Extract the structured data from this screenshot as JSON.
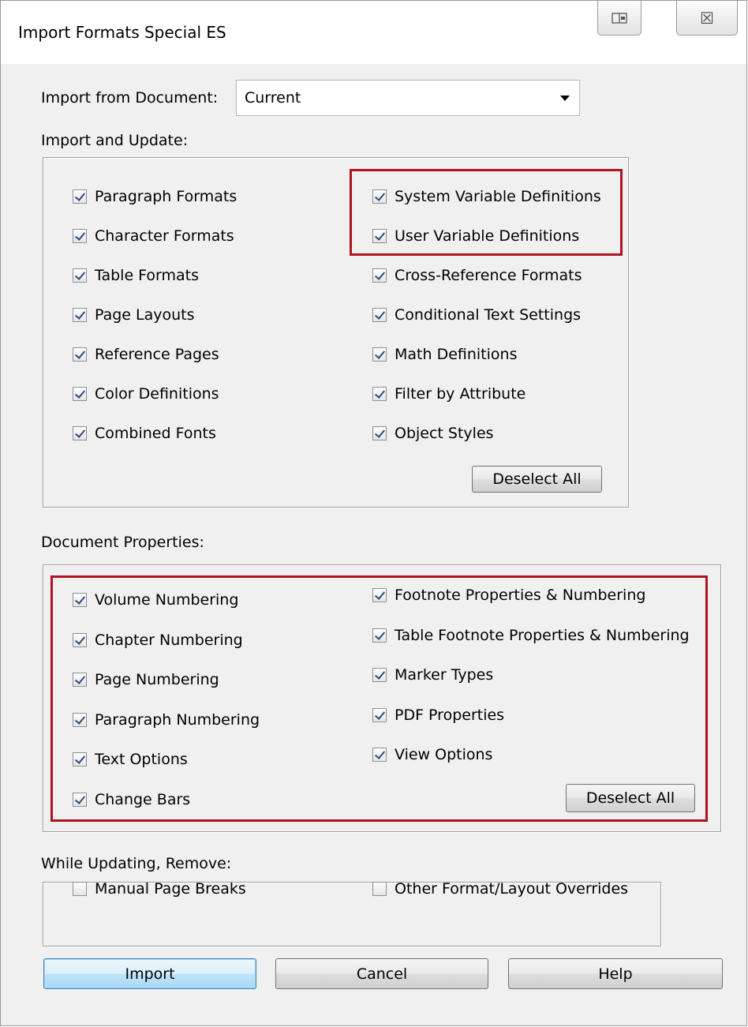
{
  "window": {
    "title": "Import Formats Special ES",
    "buttons": [
      "restore-icon",
      "close-icon"
    ],
    "close_glyph": "☒"
  },
  "import_from": {
    "label": "Import from Document:",
    "value": "Current"
  },
  "import_update": {
    "label": "Import and Update:",
    "left": [
      {
        "label": "Paragraph Formats",
        "checked": true
      },
      {
        "label": "Character Formats",
        "checked": true
      },
      {
        "label": "Table Formats",
        "checked": true
      },
      {
        "label": "Page Layouts",
        "checked": true
      },
      {
        "label": "Reference Pages",
        "checked": true
      },
      {
        "label": "Color Definitions",
        "checked": true
      },
      {
        "label": "Combined Fonts",
        "checked": true
      }
    ],
    "right": [
      {
        "label": "System Variable Definitions",
        "checked": true
      },
      {
        "label": "User Variable Definitions",
        "checked": true
      },
      {
        "label": "Cross-Reference Formats",
        "checked": true
      },
      {
        "label": "Conditional Text Settings",
        "checked": true
      },
      {
        "label": "Math Definitions",
        "checked": true
      },
      {
        "label": "Filter by Attribute",
        "checked": true
      },
      {
        "label": "Object Styles",
        "checked": true
      }
    ],
    "deselect_label": "Deselect All"
  },
  "doc_props": {
    "label": "Document Properties:",
    "left": [
      {
        "label": "Volume Numbering",
        "checked": true
      },
      {
        "label": "Chapter Numbering",
        "checked": true
      },
      {
        "label": "Page Numbering",
        "checked": true
      },
      {
        "label": "Paragraph Numbering",
        "checked": true
      },
      {
        "label": "Text Options",
        "checked": true
      },
      {
        "label": "Change Bars",
        "checked": true
      }
    ],
    "right": [
      {
        "label": "Footnote Properties & Numbering",
        "checked": true
      },
      {
        "label": "Table Footnote Properties & Numbering",
        "checked": true
      },
      {
        "label": "Marker Types",
        "checked": true
      },
      {
        "label": "PDF Properties",
        "checked": true
      },
      {
        "label": "View Options",
        "checked": true
      }
    ],
    "deselect_label": "Deselect All"
  },
  "remove": {
    "label": "While Updating, Remove:",
    "items": [
      {
        "label": "Manual Page Breaks",
        "checked": false
      },
      {
        "label": "Other Format/Layout Overrides",
        "checked": false
      }
    ]
  },
  "footer": {
    "import_label": "Import",
    "cancel_label": "Cancel",
    "help_label": "Help"
  },
  "colors": {
    "highlight": "#b0141e",
    "default_button": "#3c7fb1",
    "dialog_bg": "#f0f0f0"
  }
}
